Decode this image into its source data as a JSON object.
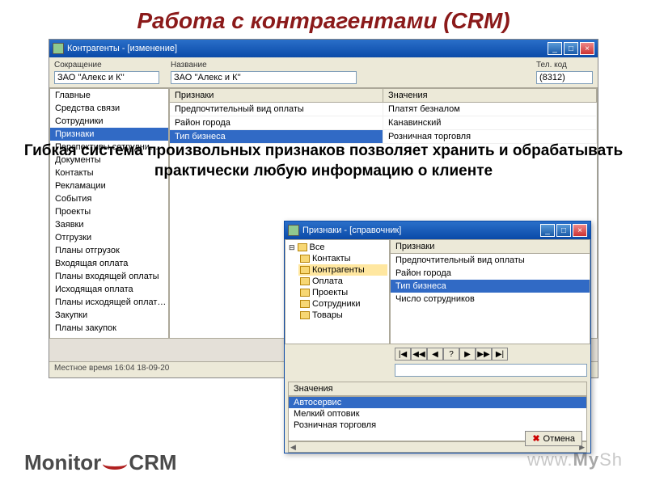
{
  "slide_title": "Работа с контрагентами (CRM)",
  "window1": {
    "title": "Контрагенты - [изменение]",
    "fields": {
      "short_label": "Сокращение",
      "short_value": "ЗАО ''Алекс и К''",
      "name_label": "Название",
      "name_value": "ЗАО ''Алекс и К''",
      "tel_label": "Тел. код",
      "tel_value": "(8312)"
    },
    "sidebar": [
      "Главные",
      "Средства связи",
      "Сотрудники",
      "Признаки",
      "Перспективы сотрудни…",
      "Документы",
      "Контакты",
      "Рекламации",
      "События",
      "Проекты",
      "Заявки",
      "Отгрузки",
      "Планы отгрузок",
      "Входящая оплата",
      "Планы входящей оплаты",
      "Исходящая оплата",
      "Планы исходящей оплат…",
      "Закупки",
      "Планы закупок"
    ],
    "sidebar_selected": 3,
    "headers": {
      "c1": "Признаки",
      "c2": "Значения"
    },
    "rows": [
      {
        "c1": "Предпочтительный вид оплаты",
        "c2": "Платят безналом"
      },
      {
        "c1": "Район города",
        "c2": "Канавинский"
      },
      {
        "c1": "Тип бизнеса",
        "c2": "Розничная торговля"
      }
    ],
    "row_selected": 2,
    "status": "Местное время 16:04   18-09-20"
  },
  "overlay": "Гибкая система произвольных признаков позволяет хранить и обрабатывать практически любую информацию о клиенте",
  "window2": {
    "title": "Признаки - [справочник]",
    "tree_root": "Все",
    "tree": [
      "Контакты",
      "Контрагенты",
      "Оплата",
      "Проекты",
      "Сотрудники",
      "Товары"
    ],
    "tree_selected": 1,
    "list_header": "Признаки",
    "list": [
      "Предпочтительный вид оплаты",
      "Район города",
      "Тип бизнеса",
      "Число сотрудников"
    ],
    "list_selected": 2,
    "nav": [
      "|◀",
      "◀◀",
      "◀",
      "?",
      "▶",
      "▶▶",
      "▶|"
    ],
    "values_header": "Значения",
    "values": [
      "Автосервис",
      "Мелкий оптовик",
      "Розничная торговля"
    ],
    "values_selected": 0,
    "cancel": "Отмена"
  },
  "footer": {
    "brand1": "Monitor",
    "brand2": "CRM",
    "url1": "www.",
    "url2": "My",
    "url3": "Sh"
  }
}
